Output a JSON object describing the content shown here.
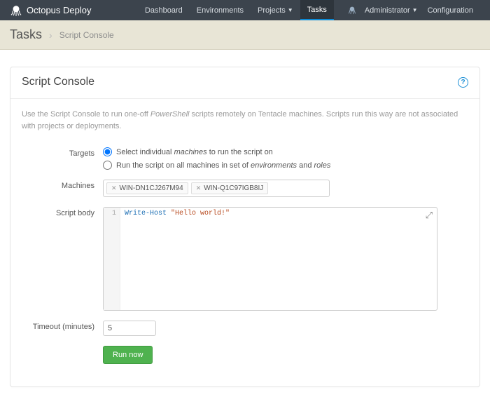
{
  "brand": "Octopus Deploy",
  "nav": {
    "dashboard": "Dashboard",
    "environments": "Environments",
    "projects": "Projects",
    "tasks": "Tasks",
    "administrator": "Administrator",
    "configuration": "Configuration"
  },
  "breadcrumb": {
    "title": "Tasks",
    "sub": "Script Console"
  },
  "card": {
    "title": "Script Console",
    "intro_prefix": "Use the Script Console to run one-off ",
    "intro_em": "PowerShell",
    "intro_suffix": " scripts remotely on Tentacle machines. Scripts run this way are not associated with projects or deployments."
  },
  "form": {
    "targets_label": "Targets",
    "target_opt1_a": "Select individual ",
    "target_opt1_em": "machines",
    "target_opt1_b": " to run the script on",
    "target_opt2_a": "Run the script on all machines in set of ",
    "target_opt2_em1": "environments",
    "target_opt2_mid": " and ",
    "target_opt2_em2": "roles",
    "machines_label": "Machines",
    "machines": [
      "WIN-DN1CJ267M94",
      "WIN-Q1C97IGB8IJ"
    ],
    "script_label": "Script body",
    "script_line1_cmd": "Write-Host ",
    "script_line1_str": "\"Hello world!\"",
    "gutter_1": "1",
    "timeout_label": "Timeout (minutes)",
    "timeout_value": "5",
    "run_label": "Run now"
  }
}
